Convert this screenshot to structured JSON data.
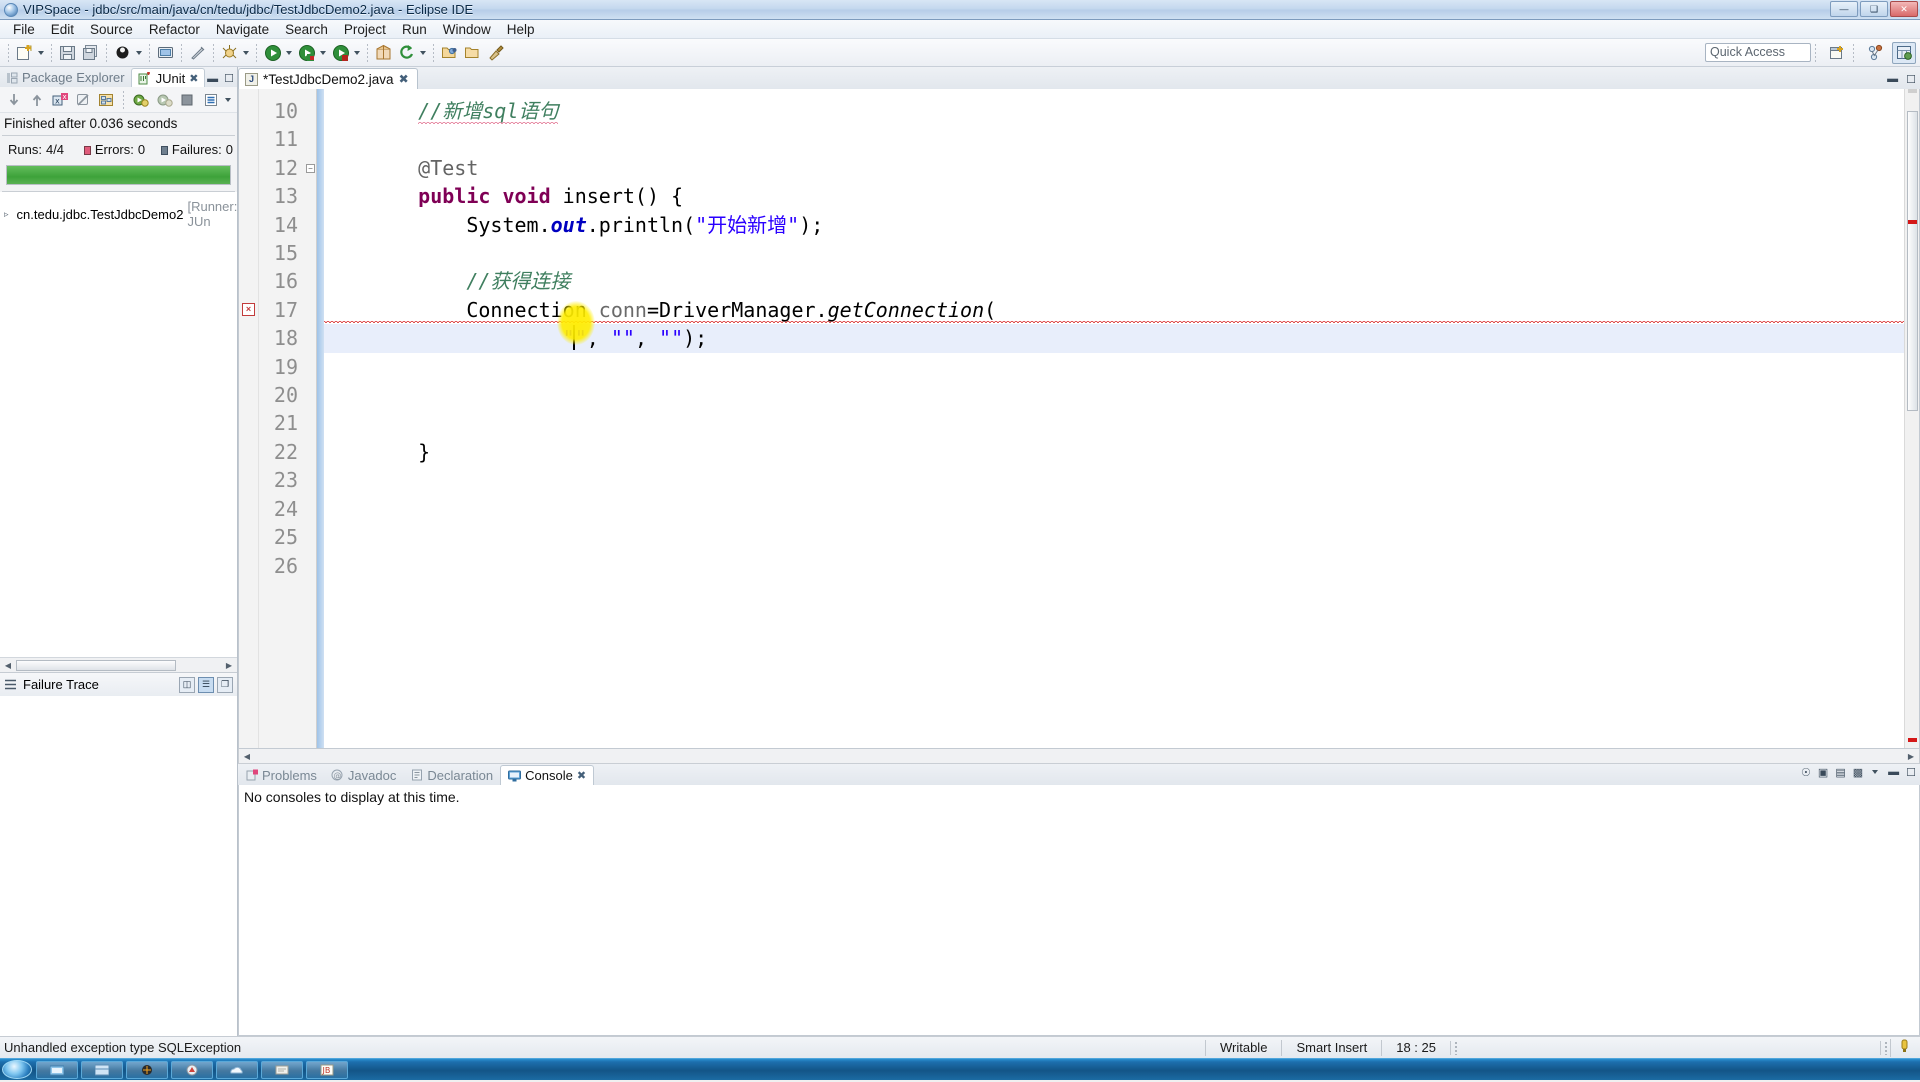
{
  "window": {
    "title": "VIPSpace - jdbc/src/main/java/cn/tedu/jdbc/TestJdbcDemo2.java - Eclipse IDE",
    "app_icon": "eclipse-icon",
    "buttons": {
      "minimize": "—",
      "maximize": "❑",
      "close": "✕"
    }
  },
  "menubar": {
    "items": [
      "File",
      "Edit",
      "Source",
      "Refactor",
      "Navigate",
      "Search",
      "Project",
      "Run",
      "Window",
      "Help"
    ]
  },
  "toolbar": {
    "quick_access_placeholder": "Quick Access",
    "icons": [
      "new-wizard-icon",
      "save-icon",
      "save-all-icon",
      "external-tools-icon",
      "print-icon",
      "toggle-mark-occurrences-icon",
      "debug-icon",
      "run-icon",
      "run-as-icon",
      "coverage-icon",
      "new-java-package-icon",
      "refresh-icon",
      "open-type-icon",
      "open-task-icon",
      "search-icon"
    ],
    "right_icons": [
      "new-perspective-icon",
      "java-perspective-icon",
      "java-ee-perspective-icon"
    ]
  },
  "junit_view": {
    "tabs": [
      {
        "label": "Package Explorer",
        "icon": "package-explorer-icon",
        "active": false
      },
      {
        "label": "JUnit",
        "icon": "junit-icon",
        "active": true,
        "close": "✖"
      }
    ],
    "view_buttons": [
      "minimize-view-icon",
      "maximize-view-icon"
    ],
    "toolbar_icons": [
      "next-failure-icon",
      "previous-failure-icon",
      "show-failures-only-icon",
      "stop-icon",
      "show-in-hierarchy-icon",
      "rerun-test-icon",
      "rerun-failed-icon",
      "terminate-icon",
      "history-icon"
    ],
    "status": "Finished after 0.036 seconds",
    "counters": {
      "runs_label": "Runs:",
      "runs_value": "4/4",
      "errors_label": "Errors:",
      "errors_value": "0",
      "failures_label": "Failures:",
      "failures_value": "0"
    },
    "progress": {
      "percent": 100,
      "color": "#43a83c"
    },
    "tree": [
      {
        "twisty": "▹",
        "icon": "test-class-icon",
        "label": "cn.tedu.jdbc.TestJdbcDemo2",
        "suffix": "[Runner: JUn"
      }
    ],
    "failure_trace": {
      "title": "Failure Trace",
      "icon": "failure-trace-icon",
      "buttons": [
        "compare-result-icon",
        "filter-stack-trace-icon",
        "copy-trace-icon"
      ]
    }
  },
  "editor": {
    "tabs": [
      {
        "label": "*TestJdbcDemo2.java",
        "icon": "java-file-icon",
        "close": "✖",
        "active": true
      }
    ],
    "tab_buttons": [
      "restore-icon",
      "maximize-icon"
    ],
    "first_visible_line": 9,
    "lines": [
      {
        "num": 10,
        "folding": "",
        "annotation": "",
        "highlight": false,
        "tokens": [
          {
            "t": "    ",
            "c": ""
          },
          {
            "t": "//新增sql语句",
            "c": "cmt",
            "squiggle": "spell"
          }
        ]
      },
      {
        "num": 11,
        "folding": "",
        "annotation": "",
        "highlight": false,
        "tokens": []
      },
      {
        "num": 12,
        "folding": "collapse",
        "annotation": "",
        "highlight": false,
        "tokens": [
          {
            "t": "    ",
            "c": ""
          },
          {
            "t": "@Test",
            "c": "ann"
          }
        ]
      },
      {
        "num": 13,
        "folding": "",
        "annotation": "",
        "highlight": false,
        "tokens": [
          {
            "t": "    ",
            "c": ""
          },
          {
            "t": "public void",
            "c": "kw"
          },
          {
            "t": " insert() {",
            "c": ""
          }
        ]
      },
      {
        "num": 14,
        "folding": "",
        "annotation": "",
        "highlight": false,
        "tokens": [
          {
            "t": "        System.",
            "c": ""
          },
          {
            "t": "out",
            "c": "fld"
          },
          {
            "t": ".println(",
            "c": ""
          },
          {
            "t": "\"开始新增\"",
            "c": "str"
          },
          {
            "t": ");",
            "c": ""
          }
        ]
      },
      {
        "num": 15,
        "folding": "",
        "annotation": "",
        "highlight": false,
        "tokens": []
      },
      {
        "num": 16,
        "folding": "",
        "annotation": "",
        "highlight": false,
        "tokens": [
          {
            "t": "        ",
            "c": ""
          },
          {
            "t": "//获得连接",
            "c": "cmt"
          }
        ]
      },
      {
        "num": 17,
        "folding": "",
        "annotation": "error",
        "highlight": false,
        "tokens": [
          {
            "t": "        Connection ",
            "c": ""
          },
          {
            "t": "conn",
            "c": "lv"
          },
          {
            "t": "=DriverManager.",
            "c": ""
          },
          {
            "t": "getConnection",
            "c": "sm"
          },
          {
            "t": "(",
            "c": ""
          }
        ]
      },
      {
        "num": 18,
        "folding": "",
        "annotation": "",
        "highlight": true,
        "tokens": [
          {
            "t": "                ",
            "c": ""
          },
          {
            "t": "\"\"",
            "c": "str"
          },
          {
            "t": ", ",
            "c": ""
          },
          {
            "t": "\"\"",
            "c": "str"
          },
          {
            "t": ", ",
            "c": ""
          },
          {
            "t": "\"\"",
            "c": "str"
          },
          {
            "t": ");",
            "c": ""
          }
        ]
      },
      {
        "num": 19,
        "folding": "",
        "annotation": "",
        "highlight": false,
        "tokens": []
      },
      {
        "num": 20,
        "folding": "",
        "annotation": "",
        "highlight": false,
        "tokens": []
      },
      {
        "num": 21,
        "folding": "",
        "annotation": "",
        "highlight": false,
        "tokens": []
      },
      {
        "num": 22,
        "folding": "",
        "annotation": "",
        "highlight": false,
        "tokens": [
          {
            "t": "    }",
            "c": ""
          }
        ]
      },
      {
        "num": 23,
        "folding": "",
        "annotation": "",
        "highlight": false,
        "tokens": []
      },
      {
        "num": 24,
        "folding": "",
        "annotation": "",
        "highlight": false,
        "tokens": []
      },
      {
        "num": 25,
        "folding": "",
        "annotation": "",
        "highlight": false,
        "tokens": []
      },
      {
        "num": 26,
        "folding": "",
        "annotation": "",
        "highlight": false,
        "tokens": []
      }
    ],
    "error_marker_glyph": "×",
    "cursor": {
      "line": 18,
      "column": 25
    }
  },
  "console_view": {
    "tabs": [
      {
        "label": "Problems",
        "icon": "problems-icon",
        "active": false
      },
      {
        "label": "Javadoc",
        "icon": "javadoc-icon",
        "active": false
      },
      {
        "label": "Declaration",
        "icon": "declaration-icon",
        "active": false
      },
      {
        "label": "Console",
        "icon": "console-icon",
        "active": true,
        "close": "✖"
      }
    ],
    "toolbar_icons": [
      "open-console-icon",
      "pin-console-icon",
      "display-console-icon",
      "new-console-view-icon"
    ],
    "view_buttons": [
      "minimize-view-icon",
      "maximize-view-icon"
    ],
    "message": "No consoles to display at this time."
  },
  "statusbar": {
    "message": "Unhandled exception type SQLException",
    "writable": "Writable",
    "insert_mode": "Smart Insert",
    "position": "18 : 25"
  },
  "taskbar": {
    "start_icon": "windows-start-orb",
    "buttons": [
      "taskbar-item-1",
      "taskbar-item-2",
      "taskbar-item-3",
      "taskbar-item-4",
      "taskbar-item-5",
      "taskbar-item-6",
      "taskbar-item-7"
    ]
  },
  "colors": {
    "keyword": "#7f0055",
    "comment": "#3f7f5f",
    "string": "#2a00ff",
    "field": "#0000c0",
    "error": "#d41717",
    "junit_green": "#43a83c",
    "selection": "#e8eefb"
  }
}
